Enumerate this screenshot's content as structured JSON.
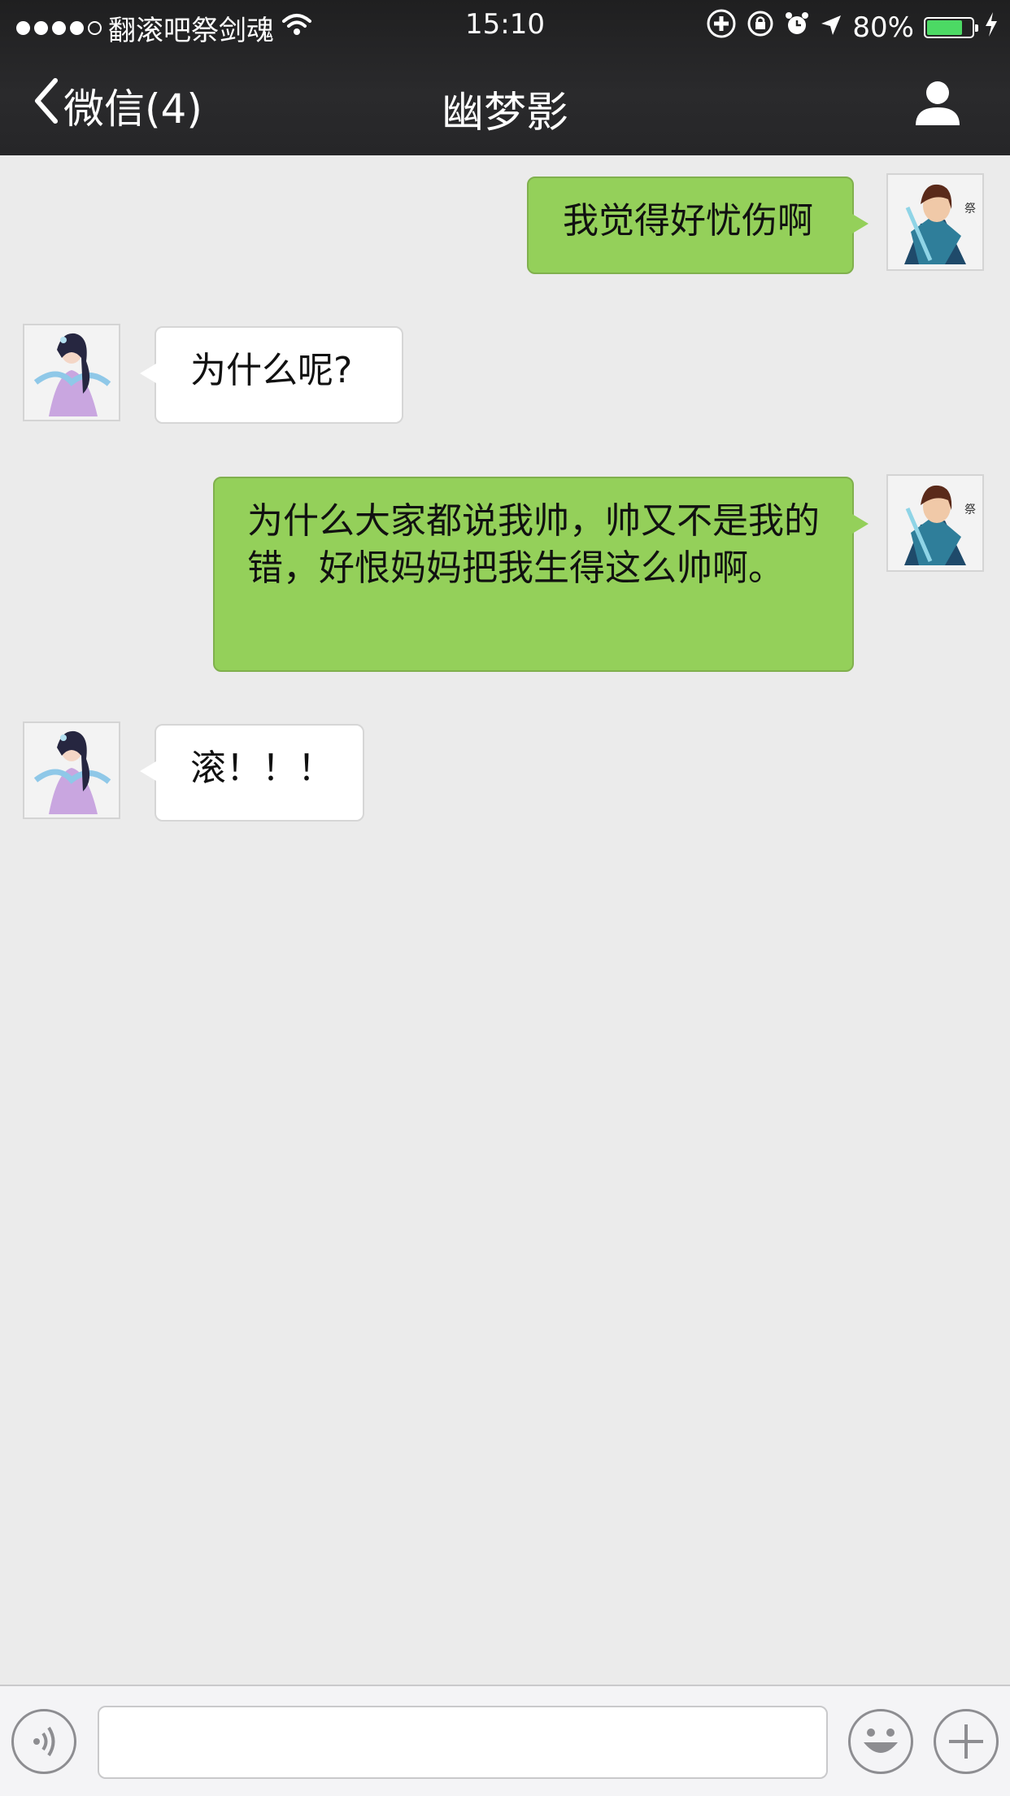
{
  "status_bar": {
    "carrier": "翻滚吧祭剑魂",
    "time": "15:10",
    "battery": "80%",
    "battery_level": 0.8,
    "signal_bars": 4,
    "signal_total": 5
  },
  "nav": {
    "back_label": "微信(4)",
    "title": "幽梦影"
  },
  "messages": [
    {
      "from": "me",
      "text": "我觉得好忧伤啊"
    },
    {
      "from": "other",
      "text": "为什么呢?"
    },
    {
      "from": "me",
      "text": "为什么大家都说我帅，帅又不是我的错，好恨妈妈把我生得这么帅啊。"
    },
    {
      "from": "other",
      "text": "滚！！！"
    }
  ],
  "input": {
    "value": "",
    "placeholder": ""
  },
  "colors": {
    "outgoing_bubble": "#94d05a",
    "incoming_bubble": "#ffffff",
    "battery_fill": "#4cd964"
  }
}
